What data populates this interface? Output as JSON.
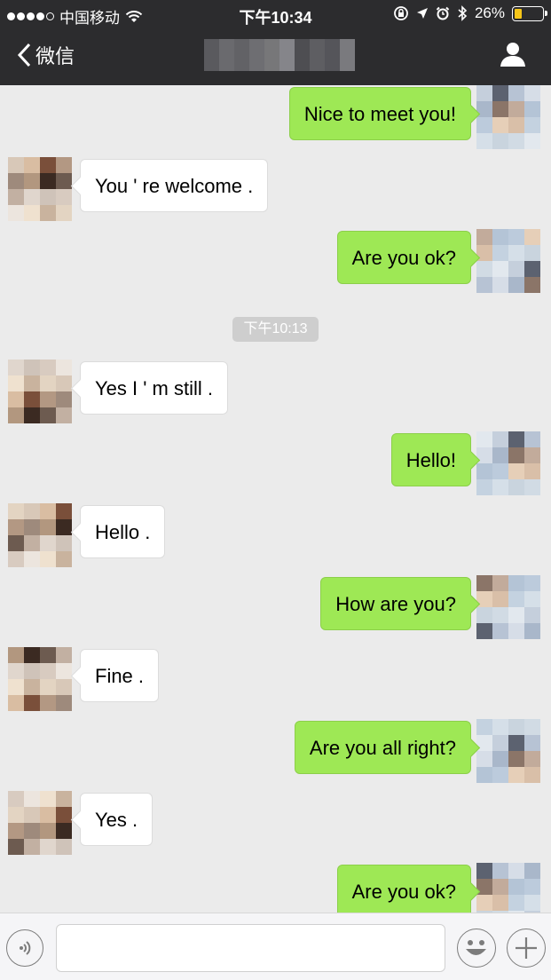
{
  "status_bar": {
    "carrier": "中国移动",
    "time": "下午10:34",
    "battery": "26%",
    "battery_level": 0.26,
    "signal_bars_filled": 4,
    "signal_bars_total": 5
  },
  "nav": {
    "back_label": "微信",
    "title_hidden": true
  },
  "chat": {
    "messages": [
      {
        "side": "out",
        "text": "Nice to meet you!"
      },
      {
        "side": "in",
        "text": "You ' re welcome ."
      },
      {
        "side": "out",
        "text": "Are you ok?"
      },
      {
        "side": "time",
        "text": "下午10:13"
      },
      {
        "side": "in",
        "text": "Yes I ' m still ."
      },
      {
        "side": "out",
        "text": "Hello!"
      },
      {
        "side": "in",
        "text": "Hello ."
      },
      {
        "side": "out",
        "text": "How are you?"
      },
      {
        "side": "in",
        "text": "Fine ."
      },
      {
        "side": "out",
        "text": "Are you all right?"
      },
      {
        "side": "in",
        "text": "Yes ."
      },
      {
        "side": "out",
        "text": "Are you ok?"
      }
    ]
  },
  "input": {
    "value": "",
    "placeholder": ""
  },
  "icons": {
    "back": "chevron-left-icon",
    "profile": "person-icon",
    "voice": "voice-icon",
    "emoji": "emoji-icon",
    "plus": "plus-icon",
    "wifi": "wifi-icon",
    "location": "location-arrow-icon",
    "alarm": "alarm-icon",
    "bluetooth": "bluetooth-icon",
    "lock_rotation": "rotation-lock-icon"
  },
  "colors": {
    "bar_background": "#2c2c2e",
    "chat_background": "#ebebeb",
    "out_bubble": "#9ee855",
    "in_bubble": "#ffffff",
    "battery": "#f5c518"
  }
}
